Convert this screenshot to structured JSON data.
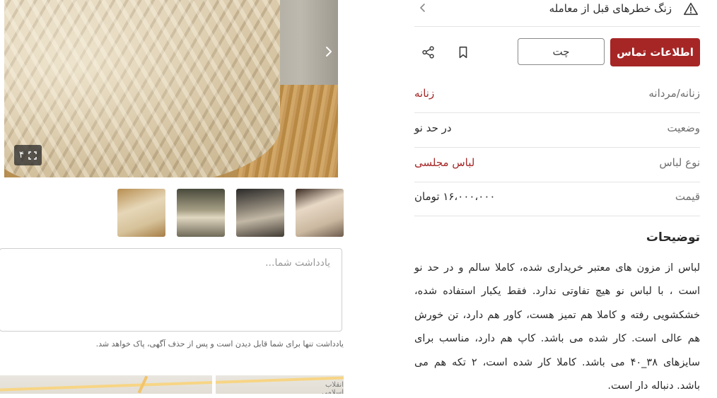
{
  "header": {
    "warning_text": "زنگ خطرهای قبل از معامله",
    "warning_icon": "warning-triangle-icon",
    "chevron_icon": "chevron-left-icon"
  },
  "actions": {
    "contact_label": "اطلاعات تماس",
    "chat_label": "چت",
    "bookmark_icon": "bookmark-icon",
    "share_icon": "share-icon"
  },
  "attributes": [
    {
      "label": "زنانه/مردانه",
      "value": "زنانه"
    },
    {
      "label": "وضعیت",
      "value": "در حد نو"
    },
    {
      "label": "نوع لباس",
      "value": "لباس مجلسی"
    },
    {
      "label": "قیمت",
      "value": "۱۶،۰۰۰،۰۰۰ تومان"
    }
  ],
  "description": {
    "title": "توضیحات",
    "text": "لباس از مزون های معتبر خریداری شده، کاملا سالم و در حد نو است ، با لباس نو هیچ تفاوتی ندارد. فقط یکبار استفاده شده، خشکشویی رفته و کاملا هم تمیز هست، کاور هم دارد، تن خورش هم عالی است. کار شده می باشد. کاپ هم دارد، مناسب برای سایزهای ۳۸_۴۰ می باشد. کاملا کار شده است، ۲ تکه هم می باشد. دنباله دار است."
  },
  "gallery": {
    "photo_count": "۴",
    "expand_icon": "fullscreen-icon",
    "next_icon": "chevron-right-icon"
  },
  "note": {
    "placeholder": "یادداشت شما...",
    "hint": "یادداشت تنها برای شما قابل دیدن است و پس از حذف آگهی، پاک خواهد شد."
  },
  "map": {
    "label": "انقلاب اسلامی"
  },
  "colors": {
    "accent": "#a62626",
    "divider": "#e4e4e4"
  }
}
